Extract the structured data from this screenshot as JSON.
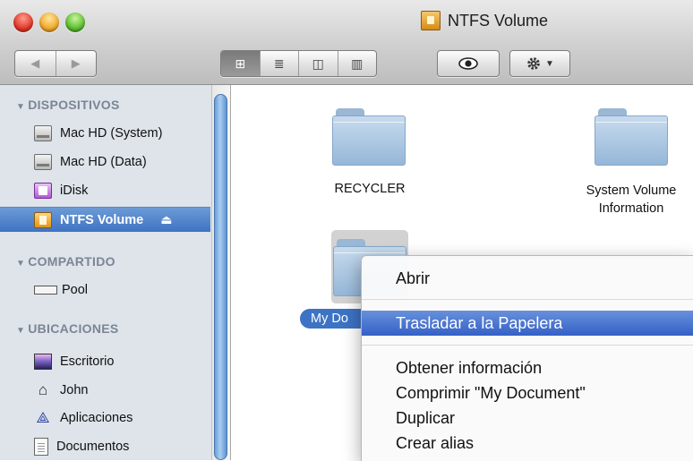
{
  "window": {
    "title": "NTFS Volume"
  },
  "toolbar": {
    "back": "◀",
    "forward": "▶",
    "views": [
      "⊞",
      "≣",
      "◫",
      "▥"
    ],
    "quicklook_icon": "eye-icon",
    "action_icon": "gear-icon"
  },
  "sidebar": {
    "devices_header": "DISPOSITIVOS",
    "devices": [
      {
        "label": "Mac HD (System)",
        "icon": "hard-drive-icon"
      },
      {
        "label": "Mac HD (Data)",
        "icon": "hard-drive-icon"
      },
      {
        "label": "iDisk",
        "icon": "idisk-icon"
      },
      {
        "label": "NTFS Volume",
        "icon": "ntfs-volume-icon",
        "selected": true
      }
    ],
    "shared_header": "COMPARTIDO",
    "shared": [
      {
        "label": "Pool",
        "icon": "network-drive-icon"
      }
    ],
    "places_header": "UBICACIONES",
    "places": [
      {
        "label": "Escritorio",
        "icon": "desktop-icon"
      },
      {
        "label": "John",
        "icon": "home-icon"
      },
      {
        "label": "Aplicaciones",
        "icon": "applications-icon"
      },
      {
        "label": "Documentos",
        "icon": "documents-icon"
      }
    ]
  },
  "files": [
    {
      "name": "RECYCLER"
    },
    {
      "name": "System Volume Information"
    },
    {
      "name": "My Document",
      "selected": true,
      "visible_label": "My Do"
    }
  ],
  "context_menu": {
    "items": [
      {
        "label": "Abrir"
      },
      {
        "label": "Trasladar a la Papelera",
        "highlighted": true
      },
      {
        "label": "Obtener información"
      },
      {
        "label": "Comprimir \"My Document\""
      },
      {
        "label": "Duplicar"
      },
      {
        "label": "Crear alias"
      }
    ]
  },
  "colors": {
    "selection": "#3d73c4",
    "sidebar_bg": "#dee4ea",
    "menu_highlight": "#3460c6"
  }
}
